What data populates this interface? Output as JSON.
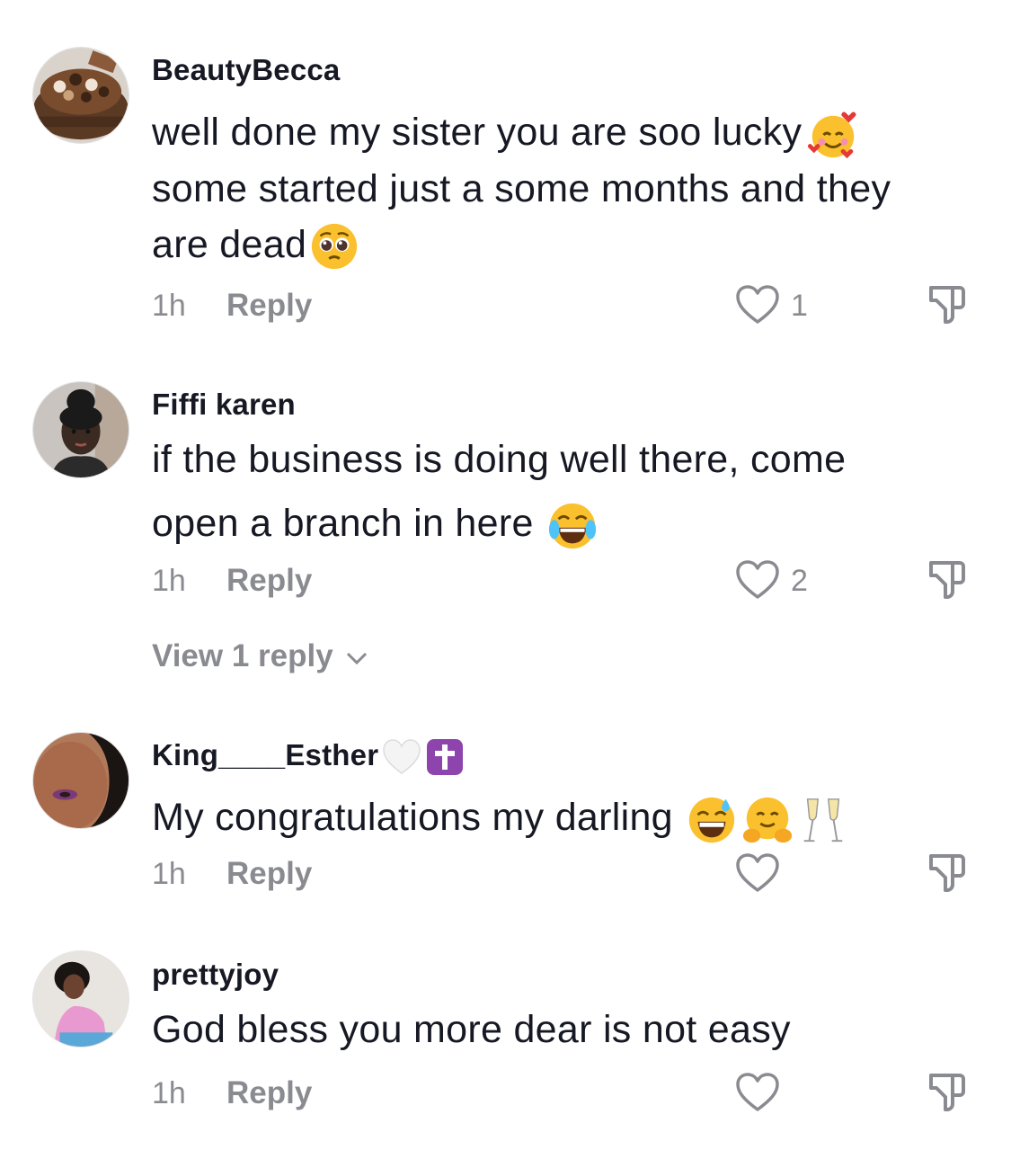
{
  "comments": [
    {
      "username": "BeautyBecca",
      "text_line1": "well done my sister you are soo lucky",
      "text_line2": "some started just a some months and they",
      "text_line3": "are dead",
      "emojis": [
        "smiling-face-with-hearts",
        "pleading-face"
      ],
      "time": "1h",
      "reply_label": "Reply",
      "likes": "1"
    },
    {
      "username": "Fiffi karen",
      "text_line1": "if the business is doing well there, come",
      "text_line2": "open a branch in here",
      "emojis": [
        "face-with-tears-of-joy"
      ],
      "time": "1h",
      "reply_label": "Reply",
      "likes": "2",
      "view_replies": "View 1 reply"
    },
    {
      "username": "King____Esther",
      "username_emojis": [
        "white-heart",
        "latin-cross"
      ],
      "text_line1": "My congratulations my darling",
      "emojis": [
        "grinning-face-with-sweat",
        "hugging-face",
        "clinking-glasses"
      ],
      "time": "1h",
      "reply_label": "Reply",
      "likes": ""
    },
    {
      "username": "prettyjoy",
      "text_line1": "God bless you more dear is not easy",
      "time": "1h",
      "reply_label": "Reply",
      "likes": ""
    }
  ],
  "colors": {
    "text_primary": "#161823",
    "text_secondary": "#8a8b91",
    "icon_gray": "#8a8b91"
  }
}
